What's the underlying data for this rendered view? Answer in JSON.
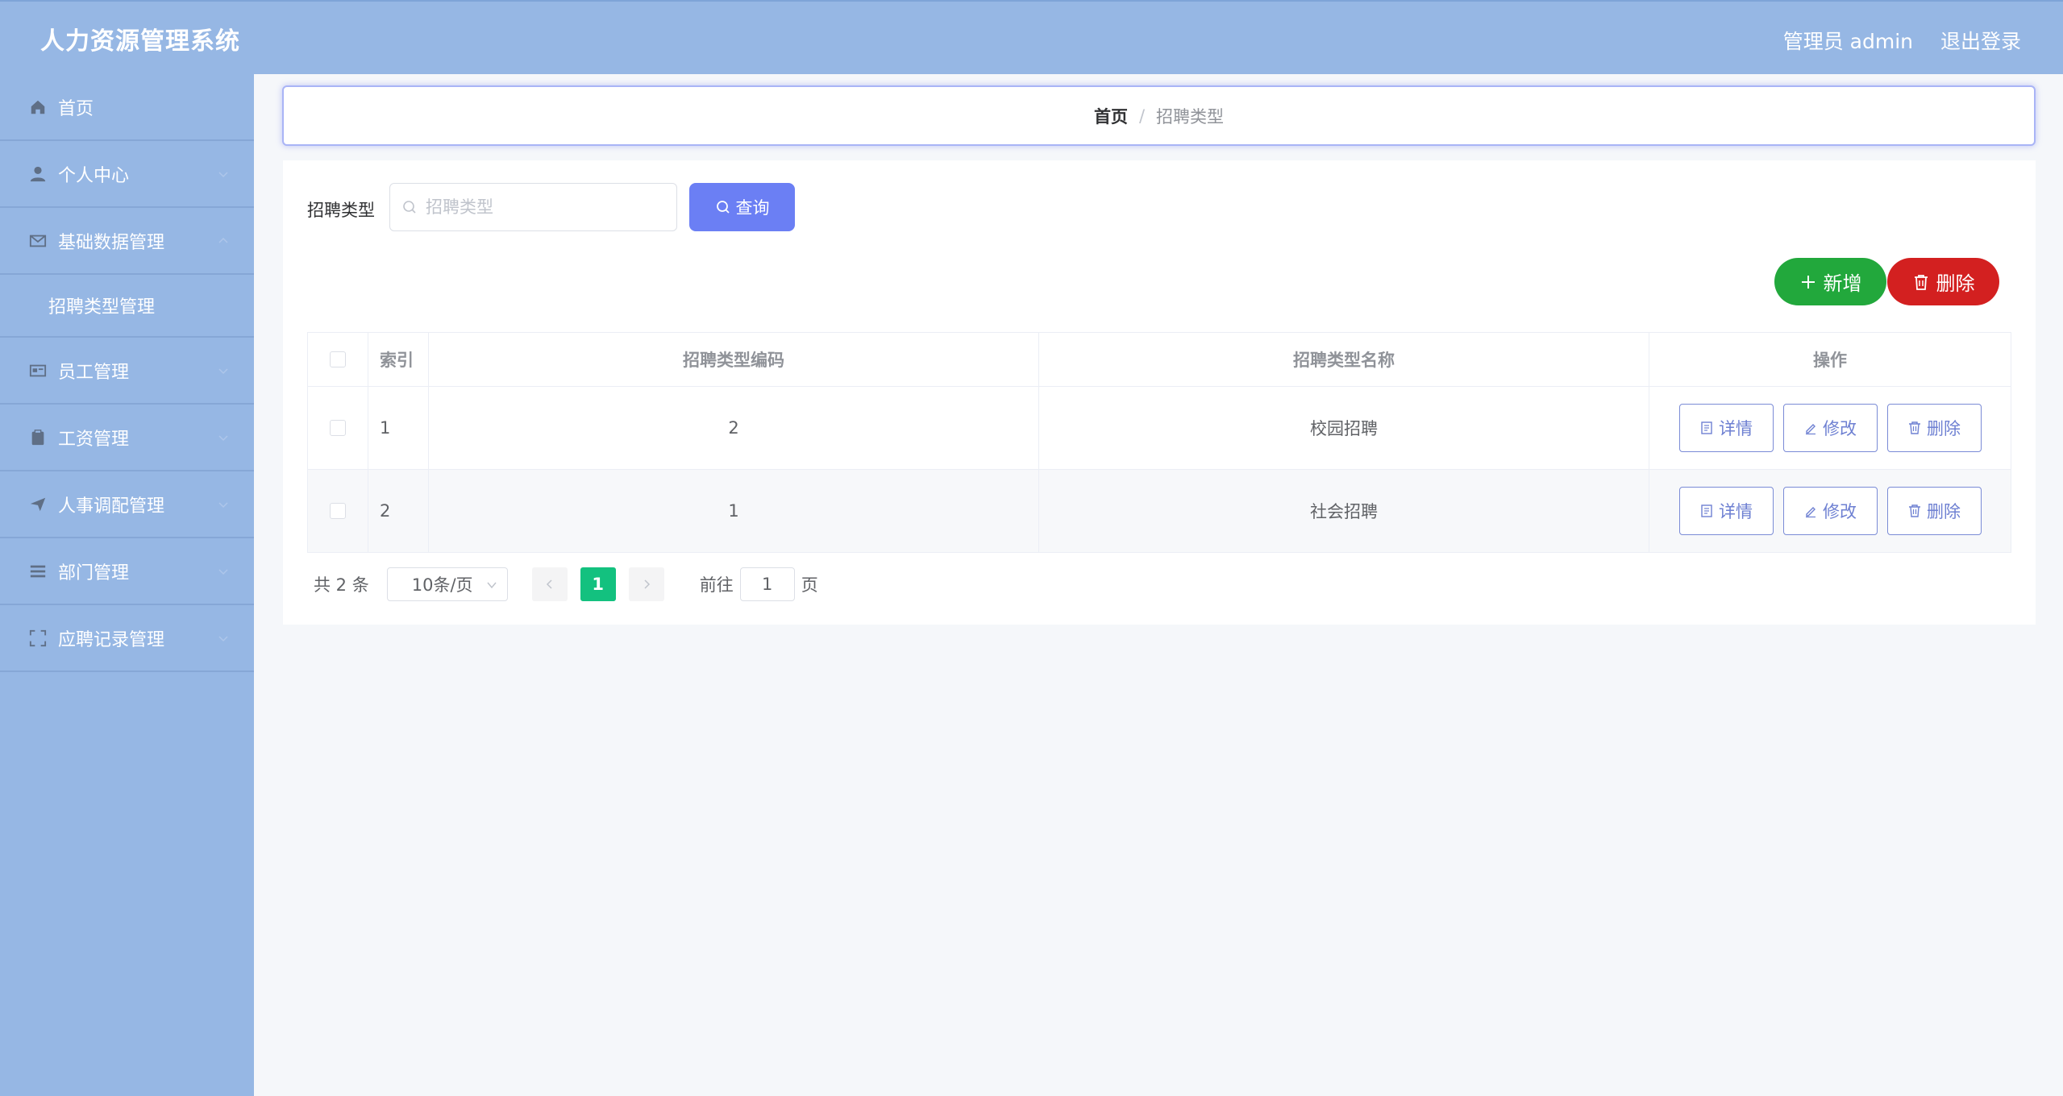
{
  "header": {
    "title": "人力资源管理系统",
    "user_label": "管理员 admin",
    "logout_label": "退出登录"
  },
  "sidebar": {
    "items": [
      {
        "label": "首页",
        "icon": "home-icon"
      },
      {
        "label": "个人中心",
        "icon": "user-icon"
      },
      {
        "label": "基础数据管理",
        "icon": "mail-icon"
      },
      {
        "label": "员工管理",
        "icon": "id-card-icon"
      },
      {
        "label": "工资管理",
        "icon": "clipboard-icon"
      },
      {
        "label": "人事调配管理",
        "icon": "send-icon"
      },
      {
        "label": "部门管理",
        "icon": "list-icon"
      },
      {
        "label": "应聘记录管理",
        "icon": "scan-icon"
      }
    ],
    "sub_item": "招聘类型管理"
  },
  "breadcrumb": {
    "home": "首页",
    "separator": "/",
    "current": "招聘类型"
  },
  "search": {
    "label": "招聘类型",
    "placeholder": "招聘类型",
    "value": "",
    "query_label": "查询"
  },
  "actions": {
    "add_label": "新增",
    "delete_label": "删除"
  },
  "table": {
    "columns": [
      "索引",
      "招聘类型编码",
      "招聘类型名称",
      "操作"
    ],
    "rows": [
      {
        "index": "1",
        "code": "2",
        "name": "校园招聘"
      },
      {
        "index": "2",
        "code": "1",
        "name": "社会招聘"
      }
    ],
    "ops": {
      "detail": "详情",
      "edit": "修改",
      "delete": "删除"
    }
  },
  "pagination": {
    "total_text": "共 2 条",
    "page_size": "10条/页",
    "current_page": "1",
    "goto_label": "前往",
    "goto_value": "1",
    "page_unit": "页"
  },
  "colors": {
    "header_bg": "#96b7e4",
    "query_button": "#6b7ff4",
    "add_button": "#22a83c",
    "delete_button": "#d32020",
    "active_page": "#13c17f"
  }
}
